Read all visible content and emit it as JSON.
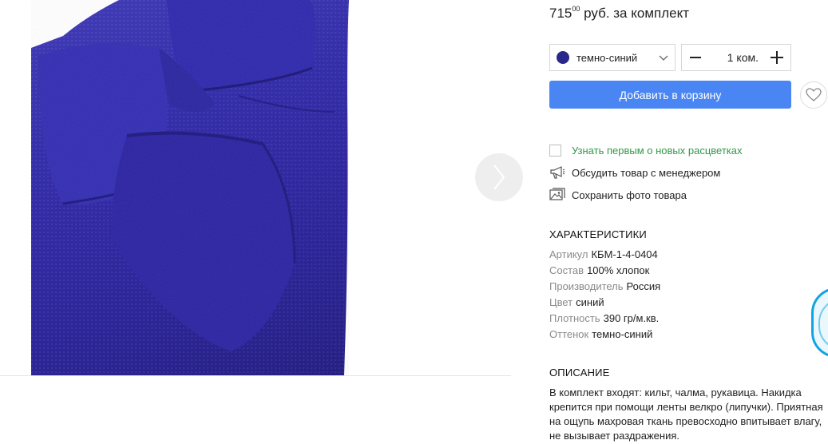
{
  "product": {
    "price_main": "715",
    "price_cents": "00",
    "price_suffix": "руб. за комплект"
  },
  "color_select": {
    "value": "темно-синий",
    "swatch_color": "#28278a"
  },
  "quantity": {
    "value": "1 ком."
  },
  "add_to_cart_label": "Добавить в корзину",
  "actions": {
    "notify": "Узнать первым о новых расцветках",
    "discuss": "Обсудить товар с менеджером",
    "save_photo": "Сохранить фото товара"
  },
  "specs": {
    "title": "ХАРАКТЕРИСТИКИ",
    "items": [
      {
        "key": "Артикул",
        "value": "КБМ-1-4-0404"
      },
      {
        "key": "Состав",
        "value": "100% хлопок"
      },
      {
        "key": "Производитель",
        "value": "Россия"
      },
      {
        "key": "Цвет",
        "value": "синий"
      },
      {
        "key": "Плотность",
        "value": "390 гр/м.кв."
      },
      {
        "key": "Оттенок",
        "value": "темно-синий"
      }
    ]
  },
  "description": {
    "title": "ОПИСАНИЕ",
    "text": "В комплект входят: кильт, чалма, рукавица. Накидка крепится при помощи ленты велкро (липучки). Приятная на ощупь махровая ткань превосходно впитывает влагу, не вызывает раздражения."
  },
  "colors": {
    "accent": "#4a86f3",
    "notify_green": "#2f9a46",
    "fabric": "#2c25a8"
  },
  "icons": {
    "next": "chevron-right-icon",
    "wishlist": "heart-icon",
    "discuss": "megaphone-icon",
    "save_photo": "image-icon"
  }
}
